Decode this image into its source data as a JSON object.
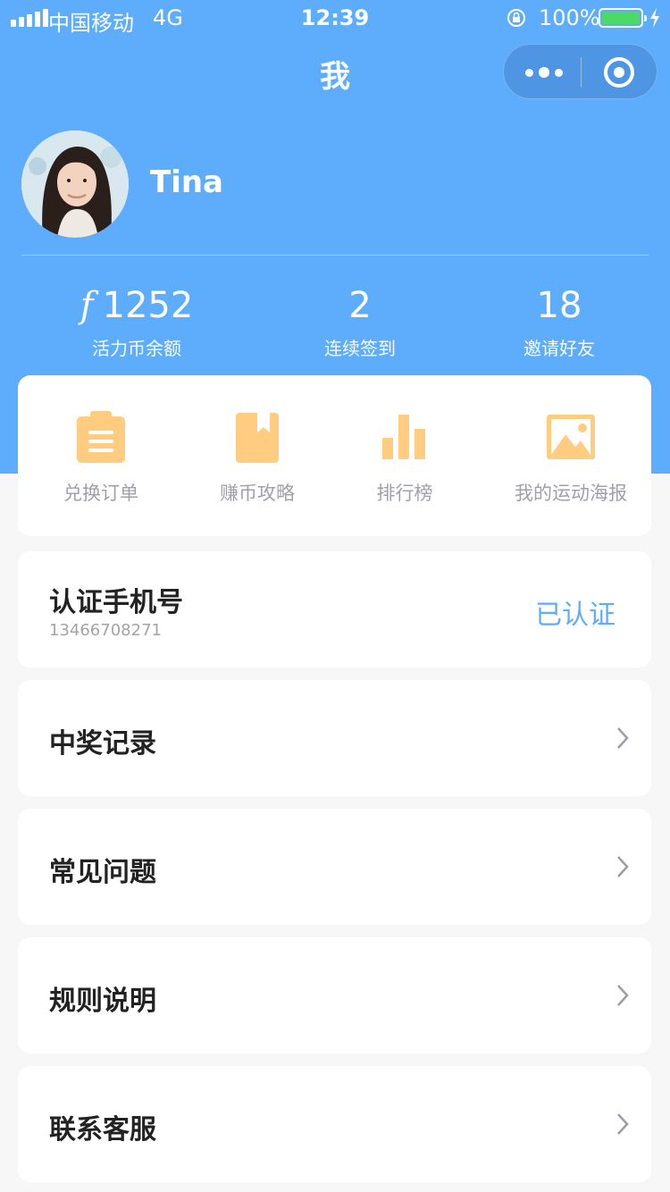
{
  "status_bar": {
    "carrier": "中国移动",
    "network": "4G",
    "time": "12:39",
    "battery_percent": "100%",
    "battery_level": 1.0
  },
  "nav": {
    "title": "我"
  },
  "profile": {
    "username": "Tina"
  },
  "stats": [
    {
      "icon": "coin-icon",
      "value": "1252",
      "label": "活力币余额"
    },
    {
      "value": "2",
      "label": "连续签到"
    },
    {
      "value": "18",
      "label": "邀请好友"
    }
  ],
  "quick_actions": [
    {
      "icon": "clipboard-icon",
      "label": "兑换订单"
    },
    {
      "icon": "bookmark-icon",
      "label": "赚币攻略"
    },
    {
      "icon": "bar-chart-icon",
      "label": "排行榜"
    },
    {
      "icon": "image-icon",
      "label": "我的运动海报"
    }
  ],
  "phone_card": {
    "title": "认证手机号",
    "phone": "13466708271",
    "status": "已认证"
  },
  "menu": [
    {
      "label": "中奖记录"
    },
    {
      "label": "常见问题"
    },
    {
      "label": "规则说明"
    },
    {
      "label": "联系客服"
    }
  ],
  "colors": {
    "header_blue": "#5eadfd",
    "icon_orange": "#ffcc80",
    "background": "#f7f7f7"
  }
}
